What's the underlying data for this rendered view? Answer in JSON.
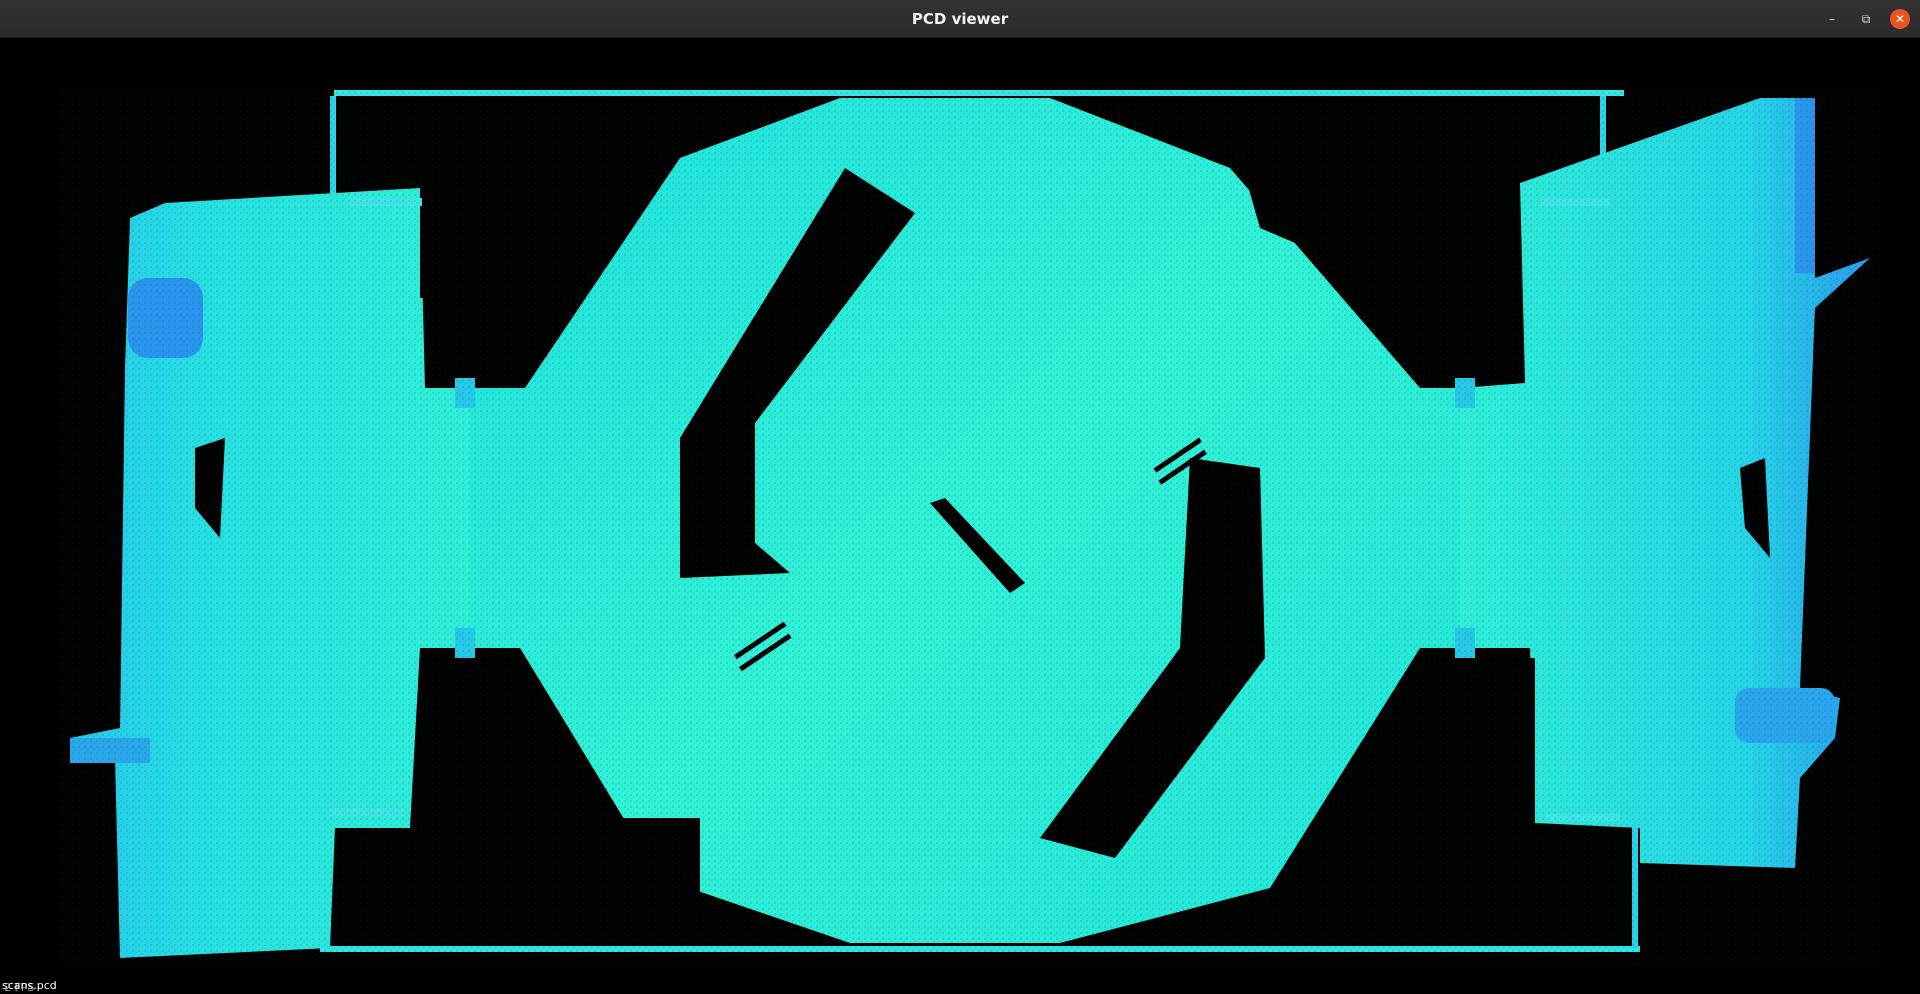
{
  "window": {
    "title": "PCD viewer",
    "controls": {
      "minimize_glyph": "–",
      "maximize_glyph": "⧉",
      "close_glyph": "✕"
    }
  },
  "viewport": {
    "background_color": "#000000",
    "point_colors": {
      "floor_primary": "#2cf0d8",
      "floor_light": "#4ff7de",
      "wall_cyan": "#1ad6e8",
      "wall_blue": "#2a9cf0"
    },
    "overlay": {
      "file_label": "scans.pcd",
      "fps_label": "2 FPS"
    }
  }
}
